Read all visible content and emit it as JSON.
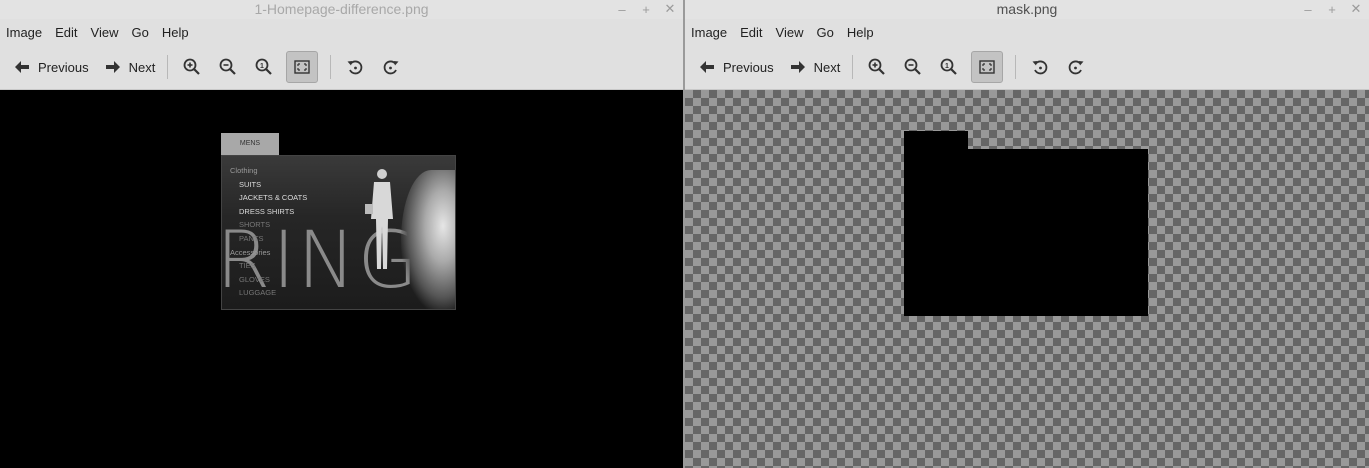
{
  "windows": [
    {
      "title": "1-Homepage-difference.png",
      "controls": {
        "minimize": "–",
        "maximize": "+",
        "close": "✕"
      },
      "menu": [
        "Image",
        "Edit",
        "View",
        "Go",
        "Help"
      ],
      "toolbar": {
        "previous_label": "Previous",
        "next_label": "Next",
        "icons": [
          "zoom-in-icon",
          "zoom-out-icon",
          "zoom-original-icon",
          "best-fit-icon",
          "rotate-left-icon",
          "rotate-right-icon"
        ]
      },
      "image": {
        "tab_label": "MENS",
        "category": "Clothing",
        "items": [
          "SUITS",
          "JACKETS & COATS",
          "DRESS SHIRTS",
          "SHORTS",
          "PANTS"
        ],
        "category2": "Accessories",
        "items2": [
          "TIES",
          "GLOVES",
          "LUGGAGE"
        ],
        "big_text": "RING"
      }
    },
    {
      "title": "mask.png",
      "controls": {
        "minimize": "–",
        "maximize": "+",
        "close": "✕"
      },
      "menu": [
        "Image",
        "Edit",
        "View",
        "Go",
        "Help"
      ],
      "toolbar": {
        "previous_label": "Previous",
        "next_label": "Next",
        "icons": [
          "zoom-in-icon",
          "zoom-out-icon",
          "zoom-original-icon",
          "best-fit-icon",
          "rotate-left-icon",
          "rotate-right-icon"
        ]
      }
    }
  ]
}
